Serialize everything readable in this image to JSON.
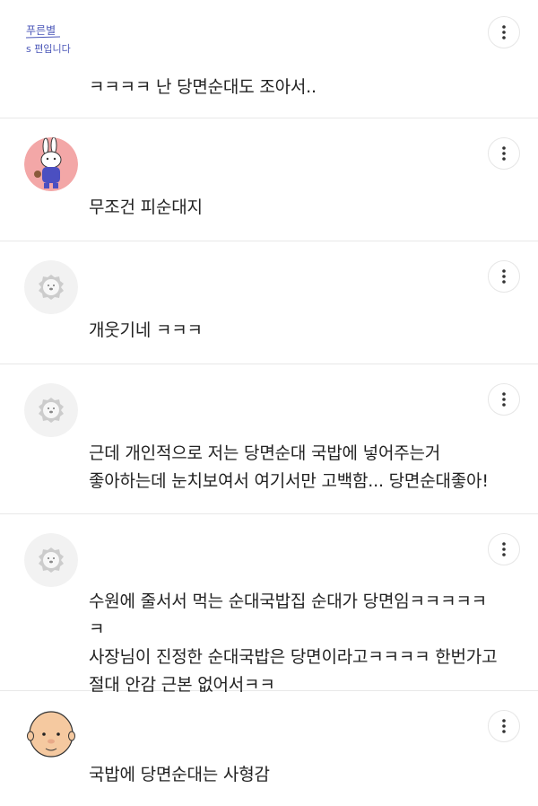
{
  "comments": [
    {
      "avatar_type": "handwriting-logo",
      "avatar_text_line1": "푸른별",
      "avatar_text_line2": "s 편입니다",
      "text": "ㅋㅋㅋㅋ 난 당면순대도 조아서.."
    },
    {
      "avatar_type": "rabbit-character",
      "text": "무조건 피순대지"
    },
    {
      "avatar_type": "default-lion",
      "text": "개웃기네 ㅋㅋㅋ"
    },
    {
      "avatar_type": "default-lion",
      "text": "근데 개인적으로 저는 당면순대 국밥에 넣어주는거\n좋아하는데 눈치보여서 여기서만 고백함... 당면순대좋아!"
    },
    {
      "avatar_type": "default-lion",
      "text": "수원에 줄서서 먹는 순대국밥집 순대가 당면임ㅋㅋㅋㅋㅋㅋ\n사장님이 진정한 순대국밥은 당면이라고ㅋㅋㅋㅋ 한번가고\n절대 안감 근본 없어서ㅋㅋ"
    },
    {
      "avatar_type": "bald-character",
      "text": "국밥에 당면순대는 사형감"
    }
  ],
  "colors": {
    "text": "#222222",
    "divider": "#e8e8e8",
    "avatar_default_bg": "#f2f2f2",
    "rabbit_bg": "#f3a7a7",
    "handwriting_blue": "#4a56b8"
  },
  "icons": {
    "more": "more-vertical-icon"
  }
}
